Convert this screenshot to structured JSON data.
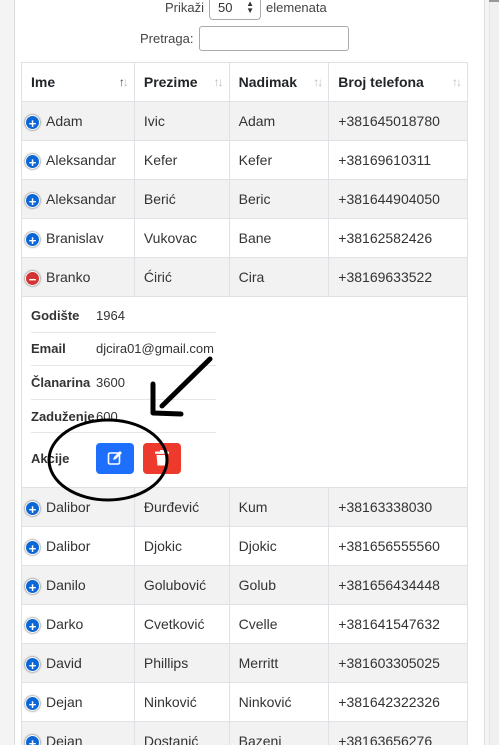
{
  "length_control": {
    "prefix": "Prikaži",
    "value": "50",
    "suffix": "elemenata"
  },
  "search": {
    "label": "Pretraga:",
    "value": ""
  },
  "table": {
    "headers": [
      "Ime",
      "Prezime",
      "Nadimak",
      "Broj telefona"
    ],
    "rows_before": [
      {
        "ime": "Adam",
        "prezime": "Ivic",
        "nadimak": "Adam",
        "telefon": "+381645018780"
      },
      {
        "ime": "Aleksandar",
        "prezime": "Kefer",
        "nadimak": "Kefer",
        "telefon": "+38169610311"
      },
      {
        "ime": "Aleksandar",
        "prezime": "Berić",
        "nadimak": "Beric",
        "telefon": "+381644904050"
      },
      {
        "ime": "Branislav",
        "prezime": "Vukovac",
        "nadimak": "Bane",
        "telefon": "+38162582426"
      }
    ],
    "expanded_row": {
      "ime": "Branko",
      "prezime": "Ćirić",
      "nadimak": "Cira",
      "telefon": "+38169633522"
    },
    "details": {
      "godiste_label": "Godište",
      "godiste_value": "1964",
      "email_label": "Email",
      "email_value": "djcira01@gmail.com",
      "clanarina_label": "Članarina",
      "clanarina_value": "3600",
      "zaduzenje_label": "Zaduženje",
      "zaduzenje_value": "600",
      "akcije_label": "Akcije"
    },
    "rows_after": [
      {
        "ime": "Dalibor",
        "prezime": "Đurđević",
        "nadimak": "Kum",
        "telefon": "+38163338030"
      },
      {
        "ime": "Dalibor",
        "prezime": "Djokic",
        "nadimak": "Djokic",
        "telefon": "+381656555560"
      },
      {
        "ime": "Danilo",
        "prezime": "Golubović",
        "nadimak": "Golub",
        "telefon": "+381656434448"
      },
      {
        "ime": "Darko",
        "prezime": "Cvetković",
        "nadimak": "Cvelle",
        "telefon": "+381641547632"
      },
      {
        "ime": "David",
        "prezime": "Phillips",
        "nadimak": "Merritt",
        "telefon": "+381603305025"
      },
      {
        "ime": "Dejan",
        "prezime": "Ninković",
        "nadimak": "Ninković",
        "telefon": "+381642322326"
      },
      {
        "ime": "Dejan",
        "prezime": "Dostanić",
        "nadimak": "Bazeni",
        "telefon": "+38163656276"
      }
    ]
  },
  "icons": {
    "expand": "plus-circle-icon",
    "collapse": "minus-circle-icon",
    "edit": "edit-icon",
    "delete": "trash-icon"
  },
  "colors": {
    "edit_button": "#1f6fff",
    "delete_button": "#ee3a2c",
    "expand_icon": "#0b66d6",
    "collapse_icon": "#d33333"
  }
}
